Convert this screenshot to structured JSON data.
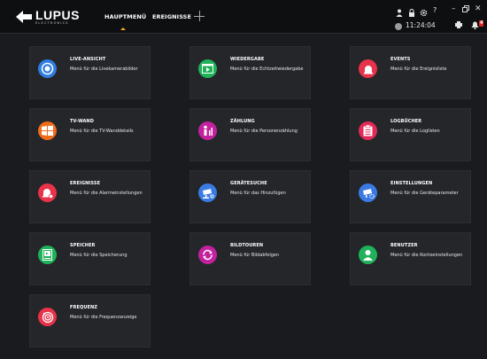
{
  "brand": {
    "name": "LUPUS",
    "tagline": "ELECTRONICS"
  },
  "nav": {
    "main": "HAUPTMENÜ",
    "events": "EREIGNISSE"
  },
  "status": {
    "time": "11:24:04",
    "alarm_count": "4"
  },
  "colors": {
    "background": "#1a1b1e",
    "tile": "#24262a",
    "accent": "#f5a623",
    "alarm": "#e02424"
  },
  "tiles": [
    {
      "title": "LIVE-ANSICHT",
      "desc": "Menü für die Livekamerabilder",
      "icon": "live-view-icon",
      "color": "#2f7de1"
    },
    {
      "title": "WIEDERGABE",
      "desc": "Menü für die Echtzeitwiedergabe",
      "icon": "playback-icon",
      "color": "#1fb25a"
    },
    {
      "title": "EVENTS",
      "desc": "Menü für die Ereignisliste",
      "icon": "siren-icon",
      "color": "#e8334a"
    },
    {
      "title": "TV-WAND",
      "desc": "Menü für die TV-Wanddetails",
      "icon": "tv-wall-icon",
      "color": "#ef6c1a"
    },
    {
      "title": "ZÄHLUNG",
      "desc": "Menü für die Personenzählung",
      "icon": "people-count-icon",
      "color": "#c3219e"
    },
    {
      "title": "LOGBÜCHER",
      "desc": "Menü für die Loglisten",
      "icon": "clipboard-icon",
      "color": "#e32a58"
    },
    {
      "title": "EREIGNISSE",
      "desc": "Menü für die Alarmeinstellungen",
      "icon": "alarm-settings-icon",
      "color": "#e8334a"
    },
    {
      "title": "GERÄTESUCHE",
      "desc": "Menü für das Hinzufügen",
      "icon": "camera-search-icon",
      "color": "#3a7be3"
    },
    {
      "title": "EINSTELLUNGEN",
      "desc": "Menü für die Geräteparameter",
      "icon": "camera-settings-icon",
      "color": "#3a7be3"
    },
    {
      "title": "SPEICHER",
      "desc": "Menü für die Speicherung",
      "icon": "storage-icon",
      "color": "#1fb25a"
    },
    {
      "title": "BILDTOUREN",
      "desc": "Menü für Bildabfolgen",
      "icon": "tour-icon",
      "color": "#c3219e"
    },
    {
      "title": "BENUTZER",
      "desc": "Menü für die Kontoeinstellungen",
      "icon": "user-icon",
      "color": "#1fb25a"
    },
    {
      "title": "FREQUENZ",
      "desc": "Menü für die Frequenzanzeige",
      "icon": "frequency-icon",
      "color": "#e8334a"
    }
  ]
}
